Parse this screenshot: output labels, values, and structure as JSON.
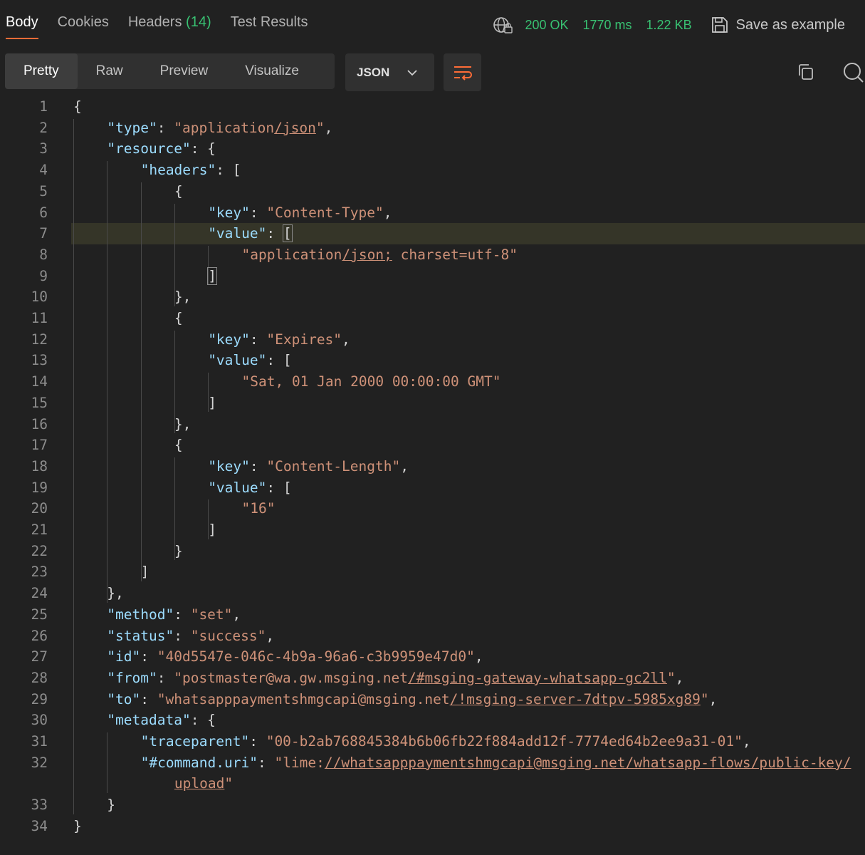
{
  "tabs": [
    {
      "label": "Body",
      "count": ""
    },
    {
      "label": "Cookies",
      "count": ""
    },
    {
      "label": "Headers",
      "count": "(14)"
    },
    {
      "label": "Test Results",
      "count": ""
    }
  ],
  "status": {
    "code": "200 OK",
    "time": "1770 ms",
    "size": "1.22 KB",
    "save_label": "Save as example"
  },
  "view_tabs": [
    "Pretty",
    "Raw",
    "Preview",
    "Visualize"
  ],
  "format": {
    "selected": "JSON"
  },
  "colors": {
    "accent": "#ff6c37",
    "success": "#38c172",
    "key": "#9cdcfe",
    "string": "#ce9178"
  },
  "code": {
    "highlighted_line": 7,
    "lines": [
      {
        "n": "1",
        "t": [
          {
            "p": "{"
          }
        ]
      },
      {
        "n": "2",
        "t": [
          {
            "k": "\"type\""
          },
          {
            "p": ": "
          },
          {
            "s": "\"application"
          },
          {
            "u": "/json"
          },
          {
            "s": "\""
          },
          {
            "p": ","
          }
        ]
      },
      {
        "n": "3",
        "t": [
          {
            "k": "\"resource\""
          },
          {
            "p": ": {"
          }
        ]
      },
      {
        "n": "4",
        "t": [
          {
            "k": "\"headers\""
          },
          {
            "p": ": ["
          }
        ]
      },
      {
        "n": "5",
        "t": [
          {
            "p": "{"
          }
        ]
      },
      {
        "n": "6",
        "t": [
          {
            "k": "\"key\""
          },
          {
            "p": ": "
          },
          {
            "s": "\"Content-Type\""
          },
          {
            "p": ","
          }
        ]
      },
      {
        "n": "7",
        "t": [
          {
            "k": "\"value\""
          },
          {
            "p": ": "
          },
          {
            "m": "["
          }
        ]
      },
      {
        "n": "8",
        "t": [
          {
            "s": "\"application"
          },
          {
            "u": "/json;"
          },
          {
            "s": " charset=utf-8\""
          }
        ]
      },
      {
        "n": "9",
        "t": [
          {
            "m": "]"
          }
        ]
      },
      {
        "n": "10",
        "t": [
          {
            "p": "},"
          }
        ]
      },
      {
        "n": "11",
        "t": [
          {
            "p": "{"
          }
        ]
      },
      {
        "n": "12",
        "t": [
          {
            "k": "\"key\""
          },
          {
            "p": ": "
          },
          {
            "s": "\"Expires\""
          },
          {
            "p": ","
          }
        ]
      },
      {
        "n": "13",
        "t": [
          {
            "k": "\"value\""
          },
          {
            "p": ": ["
          }
        ]
      },
      {
        "n": "14",
        "t": [
          {
            "s": "\"Sat, 01 Jan 2000 00:00:00 GMT\""
          }
        ]
      },
      {
        "n": "15",
        "t": [
          {
            "p": "]"
          }
        ]
      },
      {
        "n": "16",
        "t": [
          {
            "p": "},"
          }
        ]
      },
      {
        "n": "17",
        "t": [
          {
            "p": "{"
          }
        ]
      },
      {
        "n": "18",
        "t": [
          {
            "k": "\"key\""
          },
          {
            "p": ": "
          },
          {
            "s": "\"Content-Length\""
          },
          {
            "p": ","
          }
        ]
      },
      {
        "n": "19",
        "t": [
          {
            "k": "\"value\""
          },
          {
            "p": ": ["
          }
        ]
      },
      {
        "n": "20",
        "t": [
          {
            "s": "\"16\""
          }
        ]
      },
      {
        "n": "21",
        "t": [
          {
            "p": "]"
          }
        ]
      },
      {
        "n": "22",
        "t": [
          {
            "p": "}"
          }
        ]
      },
      {
        "n": "23",
        "t": [
          {
            "p": "]"
          }
        ]
      },
      {
        "n": "24",
        "t": [
          {
            "p": "},"
          }
        ]
      },
      {
        "n": "25",
        "t": [
          {
            "k": "\"method\""
          },
          {
            "p": ": "
          },
          {
            "s": "\"set\""
          },
          {
            "p": ","
          }
        ]
      },
      {
        "n": "26",
        "t": [
          {
            "k": "\"status\""
          },
          {
            "p": ": "
          },
          {
            "s": "\"success\""
          },
          {
            "p": ","
          }
        ]
      },
      {
        "n": "27",
        "t": [
          {
            "k": "\"id\""
          },
          {
            "p": ": "
          },
          {
            "s": "\"40d5547e-046c-4b9a-96a6-c3b9959e47d0\""
          },
          {
            "p": ","
          }
        ]
      },
      {
        "n": "28",
        "t": [
          {
            "k": "\"from\""
          },
          {
            "p": ": "
          },
          {
            "s": "\"postmaster@wa.gw.msging.net"
          },
          {
            "u": "/#msging-gateway-whatsapp-gc2ll"
          },
          {
            "s": "\""
          },
          {
            "p": ","
          }
        ]
      },
      {
        "n": "29",
        "t": [
          {
            "k": "\"to\""
          },
          {
            "p": ": "
          },
          {
            "s": "\"whatsapppaymentshmgcapi@msging.net"
          },
          {
            "u": "/!msging-server-7dtpv-5985xg89"
          },
          {
            "s": "\""
          },
          {
            "p": ","
          }
        ]
      },
      {
        "n": "30",
        "t": [
          {
            "k": "\"metadata\""
          },
          {
            "p": ": {"
          }
        ]
      },
      {
        "n": "31",
        "t": [
          {
            "k": "\"traceparent\""
          },
          {
            "p": ": "
          },
          {
            "s": "\"00-b2ab768845384b6b06fb22f884add12f-7774ed64b2ee9a31-01\""
          },
          {
            "p": ","
          }
        ]
      },
      {
        "n": "32",
        "t": [
          {
            "k": "\"#command.uri\""
          },
          {
            "p": ": "
          },
          {
            "s": "\"lime:"
          },
          {
            "u": "//whatsapppaymentshmgcapi@msging.net/whatsapp-flows/public-key/"
          }
        ]
      },
      {
        "n": "",
        "t": [
          {
            "u": "upload"
          },
          {
            "s": "\""
          }
        ]
      },
      {
        "n": "33",
        "t": [
          {
            "p": "}"
          }
        ]
      },
      {
        "n": "34",
        "t": [
          {
            "p": "}"
          }
        ]
      }
    ]
  }
}
